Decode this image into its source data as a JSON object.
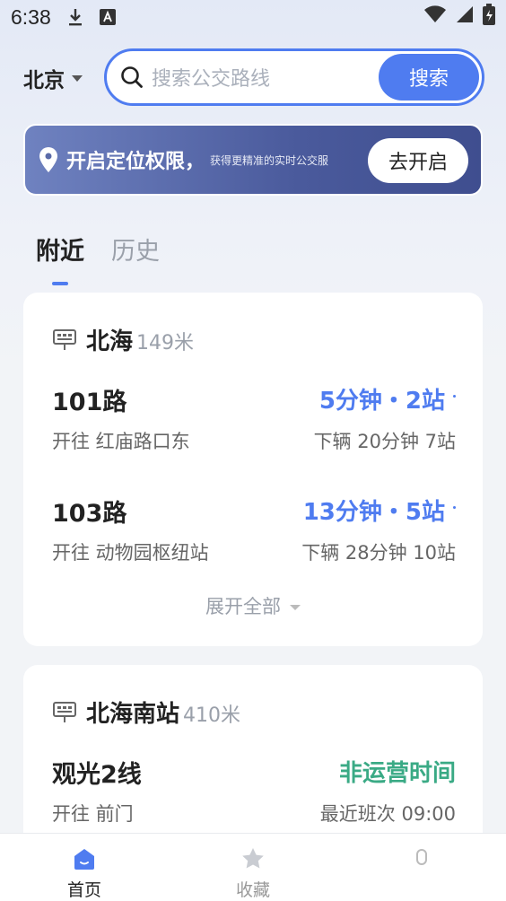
{
  "status_bar": {
    "time": "6:38"
  },
  "search": {
    "city": "北京",
    "placeholder": "搜索公交路线",
    "button": "搜索"
  },
  "location_banner": {
    "title": "开启定位权限，",
    "subtitle": "获得更精准的实时公交服",
    "button": "去开启"
  },
  "tabs": [
    {
      "label": "附近"
    },
    {
      "label": "历史"
    }
  ],
  "stops": [
    {
      "name": "北海",
      "distance": "149米",
      "routes": [
        {
          "name": "101路",
          "direction": "开往 红庙路口东",
          "eta": "5分钟・2站",
          "next": "下辆 20分钟 7站"
        },
        {
          "name": "103路",
          "direction": "开往 动物园枢纽站",
          "eta": "13分钟・5站",
          "next": "下辆 28分钟 10站"
        }
      ],
      "expand_label": "展开全部"
    },
    {
      "name": "北海南站",
      "distance": "410米",
      "routes": [
        {
          "name": "观光2线",
          "direction": "开往 前门",
          "eta": "非运营时间",
          "next": "最近班次 09:00"
        }
      ]
    }
  ],
  "bottom_nav": [
    {
      "label": "首页"
    },
    {
      "label": "收藏"
    },
    {
      "label": ""
    }
  ],
  "colors": {
    "accent": "#4f7cf0",
    "green": "#3aaa85",
    "banner": "#4a5a9c"
  }
}
